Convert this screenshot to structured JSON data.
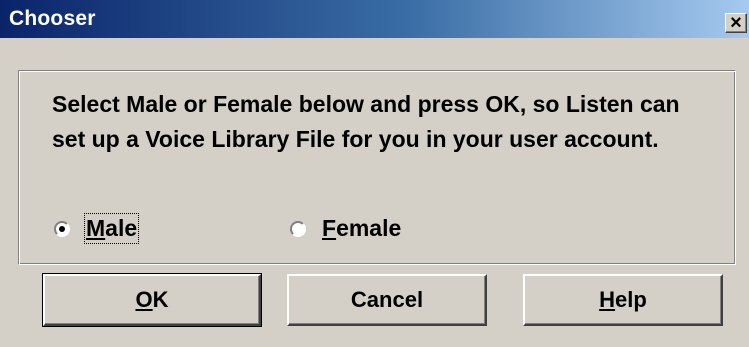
{
  "window": {
    "title": "Chooser",
    "close_label": "×"
  },
  "message": "Select Male or Female below and press OK, so Listen can set up a Voice Library File for you in your user account.",
  "options": [
    {
      "accel": "M",
      "rest": "ale",
      "checked": true
    },
    {
      "accel": "F",
      "rest": "emale",
      "checked": false
    }
  ],
  "buttons": {
    "ok": {
      "accel": "O",
      "rest": "K"
    },
    "cancel": {
      "label": "Cancel"
    },
    "help": {
      "accel": "H",
      "rest": "elp"
    }
  }
}
